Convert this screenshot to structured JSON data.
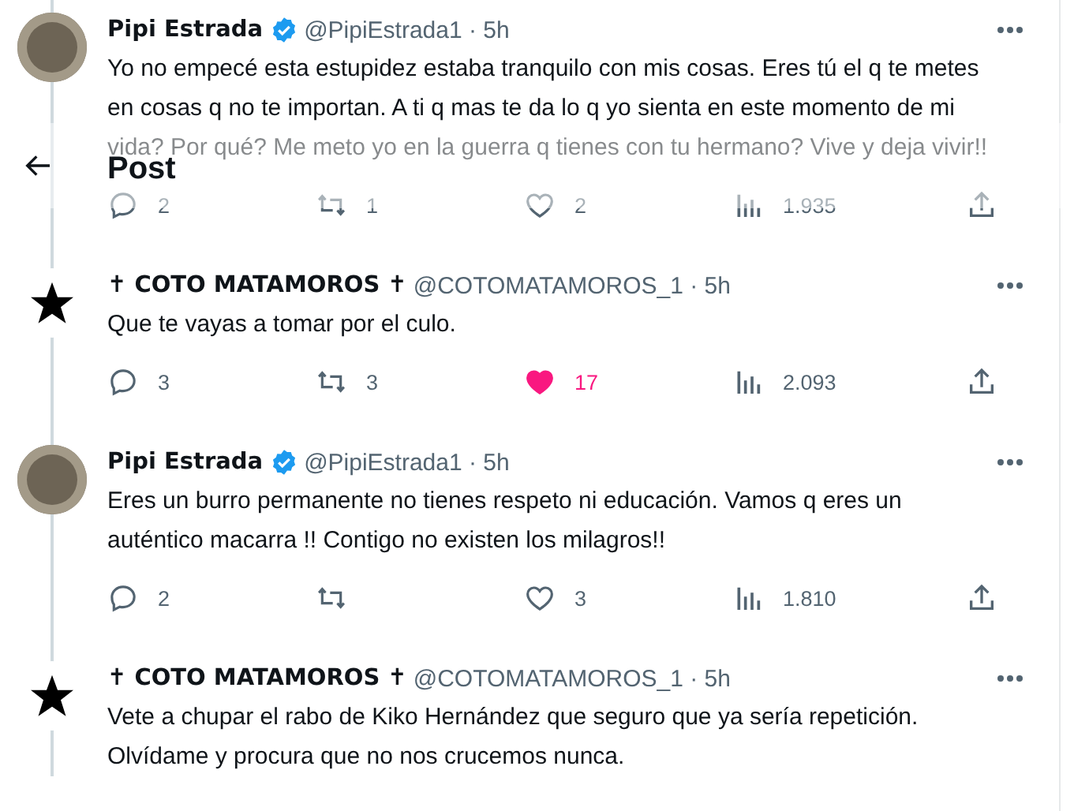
{
  "header": {
    "title": "Post"
  },
  "tweets": [
    {
      "kind": "photo",
      "author": "Pipi Estrada",
      "verified": true,
      "meta": "@PipiEstrada1 · 5h",
      "text": "Yo no empecé esta estupidez estaba tranquilo con mis cosas. Eres tú el q te metes en cosas q no te importan. A ti q mas te da lo q yo sienta en este momento de mi vida? Por qué? Me meto yo en la guerra q tienes con tu hermano? Vive y deja vivir!!",
      "replies": "2",
      "retweets": "1",
      "likes": "2",
      "liked": false,
      "views": "1.935"
    },
    {
      "kind": "star",
      "author": "✝ COTO MATAMOROS ✝",
      "verified": false,
      "meta": "@COTOMATAMOROS_1 · 5h",
      "text": "Que te vayas a tomar por el culo.",
      "replies": "3",
      "retweets": "3",
      "likes": "17",
      "liked": true,
      "views": "2.093"
    },
    {
      "kind": "photo",
      "author": "Pipi Estrada",
      "verified": true,
      "meta": "@PipiEstrada1 · 5h",
      "text": "Eres un burro permanente no tienes respeto ni educación. Vamos q eres un auténtico macarra !! Contigo no existen los milagros!!",
      "replies": "2",
      "likes": "3",
      "liked": false,
      "views": "1.810"
    },
    {
      "kind": "star",
      "author": "✝ COTO MATAMOROS ✝",
      "verified": false,
      "meta": "@COTOMATAMOROS_1 · 5h",
      "text": "Vete a chupar el rabo de Kiko Hernández que seguro que ya sería repetición. Olvídame y procura que no nos crucemos nunca."
    }
  ]
}
